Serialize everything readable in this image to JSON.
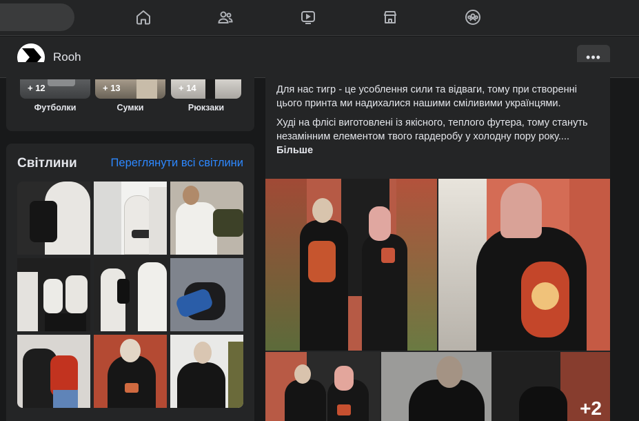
{
  "topnav": {
    "icons": [
      "home-icon",
      "friends-icon",
      "watch-icon",
      "marketplace-icon",
      "groups-icon"
    ]
  },
  "page": {
    "name": "Rooh",
    "more_label": "•••"
  },
  "categories": [
    {
      "count": "+ 12",
      "label": "Футболки"
    },
    {
      "count": "+ 13",
      "label": "Сумки"
    },
    {
      "count": "+ 14",
      "label": "Рюкзаки"
    }
  ],
  "photos": {
    "title": "Світлини",
    "view_all": "Переглянути всі світлини"
  },
  "post": {
    "para1": "Для нас тигр - це усоблення сили та відваги, тому при створенні цього принта ми надихалися нашими сміливими українцями.",
    "para2": "Худі на флісі виготовлені із якісного, теплого футера, тому стануть незамінним елементом твого гардеробу у холодну пору року.... ",
    "more": "Більше",
    "extra_count": "+2"
  },
  "colors": {
    "background": "#18191a",
    "surface": "#242526",
    "accent_link": "#2d88ff",
    "text": "#e4e6eb",
    "icon": "#b0b3b8"
  }
}
